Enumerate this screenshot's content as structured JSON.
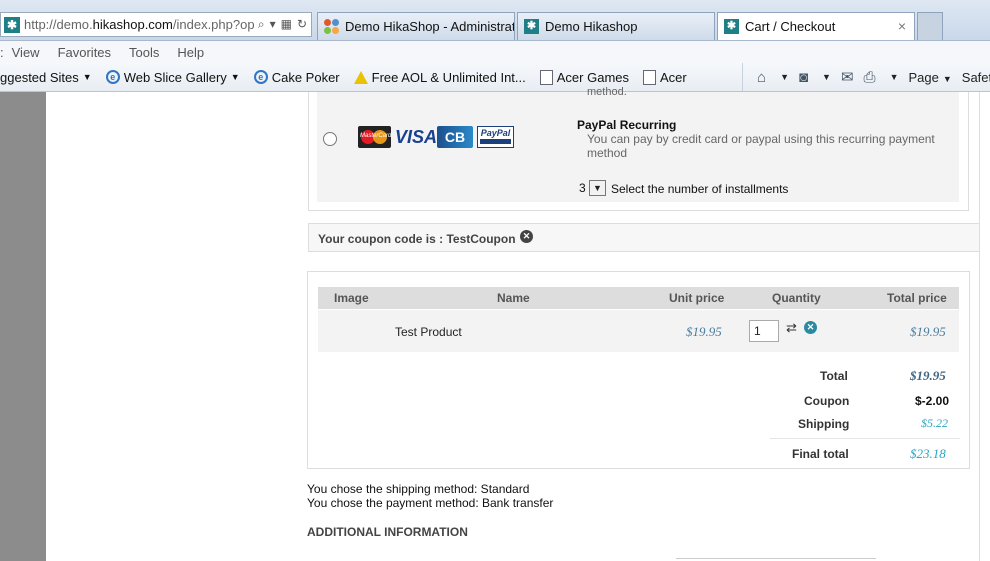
{
  "browser": {
    "address": {
      "prefix": "http://demo.",
      "domain": "hikashop.com",
      "suffix": "/index.php?op"
    },
    "tabs": [
      {
        "label": "Demo HikaShop - Administrati..."
      },
      {
        "label": "Demo Hikashop"
      },
      {
        "label": "Cart / Checkout"
      }
    ],
    "close_glyph": "×",
    "menu": [
      "View",
      "Favorites",
      "Tools",
      "Help"
    ],
    "favorites": [
      "ggested Sites",
      "Web Slice Gallery",
      "Cake Poker",
      "Free AOL & Unlimited Int...",
      "Acer Games",
      "Acer"
    ],
    "tools": {
      "page": "Page",
      "safety": "Safet"
    }
  },
  "payment": {
    "method_clip": "method.",
    "name": "PayPal Recurring",
    "description": "You can pay by credit card or paypal using this recurring payment method",
    "installments_value": "3",
    "installments_label": "Select the number of installments",
    "cards": {
      "mastercard": "MasterCard",
      "visa": "VISA",
      "cb": "CB",
      "paypal": "PayPal"
    }
  },
  "coupon": {
    "text": "Your coupon code is : TestCoupon"
  },
  "cart": {
    "headers": {
      "image": "Image",
      "name": "Name",
      "unit_price": "Unit price",
      "quantity": "Quantity",
      "total_price": "Total price"
    },
    "row": {
      "name": "Test Product",
      "unit_price": "$19.95",
      "quantity": "1",
      "total_price": "$19.95"
    },
    "totals": {
      "total_label": "Total",
      "total_value": "$19.95",
      "coupon_label": "Coupon",
      "coupon_value": "$-2.00",
      "shipping_label": "Shipping",
      "shipping_value": "$5.22",
      "final_label": "Final total",
      "final_value": "$23.18"
    }
  },
  "notes": {
    "shipping": "You chose the shipping method: Standard",
    "payment": "You chose the payment method: Bank transfer",
    "additional": "ADDITIONAL INFORMATION"
  },
  "colors": {
    "price_blue": "#4a7ea0",
    "final_blue": "#2aa4c0",
    "total_dark": "#3d6686"
  }
}
